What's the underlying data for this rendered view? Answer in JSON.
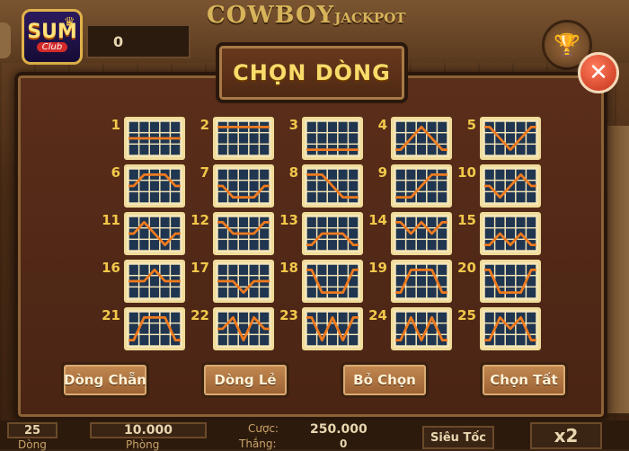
{
  "header": {
    "logo_main": "SUM",
    "logo_sub": "Club",
    "balance": "0",
    "game_title": "COWBOY",
    "game_title_suffix": "JACKPOT"
  },
  "dialog": {
    "title": "CHỌN DÒNG",
    "lines": [
      {
        "number": "1"
      },
      {
        "number": "2"
      },
      {
        "number": "3"
      },
      {
        "number": "4"
      },
      {
        "number": "5"
      },
      {
        "number": "6"
      },
      {
        "number": "7"
      },
      {
        "number": "8"
      },
      {
        "number": "9"
      },
      {
        "number": "10"
      },
      {
        "number": "11"
      },
      {
        "number": "12"
      },
      {
        "number": "13"
      },
      {
        "number": "14"
      },
      {
        "number": "15"
      },
      {
        "number": "16"
      },
      {
        "number": "17"
      },
      {
        "number": "18"
      },
      {
        "number": "19"
      },
      {
        "number": "20"
      },
      {
        "number": "21"
      },
      {
        "number": "22"
      },
      {
        "number": "23"
      },
      {
        "number": "24"
      },
      {
        "number": "25"
      }
    ],
    "buttons": {
      "even": "Dòng Chẵn",
      "odd": "Dòng Lẻ",
      "deselect": "Bỏ Chọn",
      "select_all": "Chọn Tất"
    }
  },
  "footer": {
    "lines_value": "25",
    "lines_label": "Dòng",
    "room_value": "10.000",
    "room_label": "Phòng",
    "bet_label": "Cược:",
    "bet_value": "250.000",
    "win_label": "Thắng:",
    "win_value": "0",
    "turbo_label": "Siêu Tốc",
    "multiplier": "x2"
  },
  "colors": {
    "line_highlight": "#f07a1e",
    "grid_cell": "#1f3550",
    "title_gold": "#f7dc6a"
  }
}
